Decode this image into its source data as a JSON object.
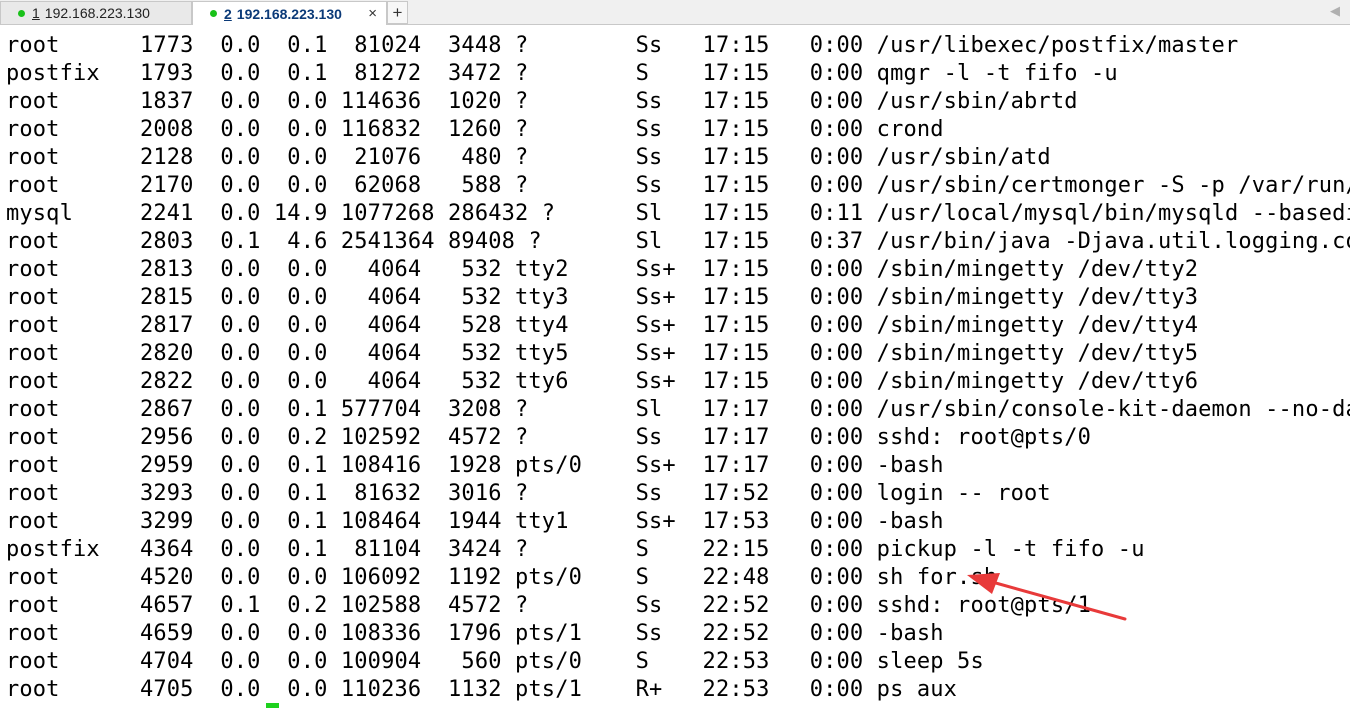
{
  "tabs": [
    {
      "number": "1",
      "label": "192.168.223.130",
      "active": false
    },
    {
      "number": "2",
      "label": "192.168.223.130",
      "active": true
    }
  ],
  "icons": {
    "new_tab": "+",
    "close": "×",
    "scroll_left": "◀"
  },
  "colors": {
    "status_dot": "#19c119",
    "cursor": "#1ed11e",
    "annotation_arrow": "#e83a3a"
  },
  "terminal_lines": [
    "root      1773  0.0  0.1  81024  3448 ?        Ss   17:15   0:00 /usr/libexec/postfix/master",
    "postfix   1793  0.0  0.1  81272  3472 ?        S    17:15   0:00 qmgr -l -t fifo -u",
    "root      1837  0.0  0.0 114636  1020 ?        Ss   17:15   0:00 /usr/sbin/abrtd",
    "root      2008  0.0  0.0 116832  1260 ?        Ss   17:15   0:00 crond",
    "root      2128  0.0  0.0  21076   480 ?        Ss   17:15   0:00 /usr/sbin/atd",
    "root      2170  0.0  0.0  62068   588 ?        Ss   17:15   0:00 /usr/sbin/certmonger -S -p /var/run/cer",
    "mysql     2241  0.0 14.9 1077268 286432 ?      Sl   17:15   0:11 /usr/local/mysql/bin/mysqld --basedir=/",
    "root      2803  0.1  4.6 2541364 89408 ?       Sl   17:15   0:37 /usr/bin/java -Djava.util.logging.confi",
    "root      2813  0.0  0.0   4064   532 tty2     Ss+  17:15   0:00 /sbin/mingetty /dev/tty2",
    "root      2815  0.0  0.0   4064   532 tty3     Ss+  17:15   0:00 /sbin/mingetty /dev/tty3",
    "root      2817  0.0  0.0   4064   528 tty4     Ss+  17:15   0:00 /sbin/mingetty /dev/tty4",
    "root      2820  0.0  0.0   4064   532 tty5     Ss+  17:15   0:00 /sbin/mingetty /dev/tty5",
    "root      2822  0.0  0.0   4064   532 tty6     Ss+  17:15   0:00 /sbin/mingetty /dev/tty6",
    "root      2867  0.0  0.1 577704  3208 ?        Sl   17:17   0:00 /usr/sbin/console-kit-daemon --no-daemo",
    "root      2956  0.0  0.2 102592  4572 ?        Ss   17:17   0:00 sshd: root@pts/0",
    "root      2959  0.0  0.1 108416  1928 pts/0    Ss+  17:17   0:00 -bash",
    "root      3293  0.0  0.1  81632  3016 ?        Ss   17:52   0:00 login -- root",
    "root      3299  0.0  0.1 108464  1944 tty1     Ss+  17:53   0:00 -bash",
    "postfix   4364  0.0  0.1  81104  3424 ?        S    22:15   0:00 pickup -l -t fifo -u",
    "root      4520  0.0  0.0 106092  1192 pts/0    S    22:48   0:00 sh for.sh",
    "root      4657  0.1  0.2 102588  4572 ?        Ss   22:52   0:00 sshd: root@pts/1",
    "root      4659  0.0  0.0 108336  1796 pts/1    Ss   22:52   0:00 -bash",
    "root      4704  0.0  0.0 100904   560 pts/0    S    22:53   0:00 sleep 5s",
    "root      4705  0.0  0.0 110236  1132 pts/1    R+   22:53   0:00 ps aux"
  ]
}
